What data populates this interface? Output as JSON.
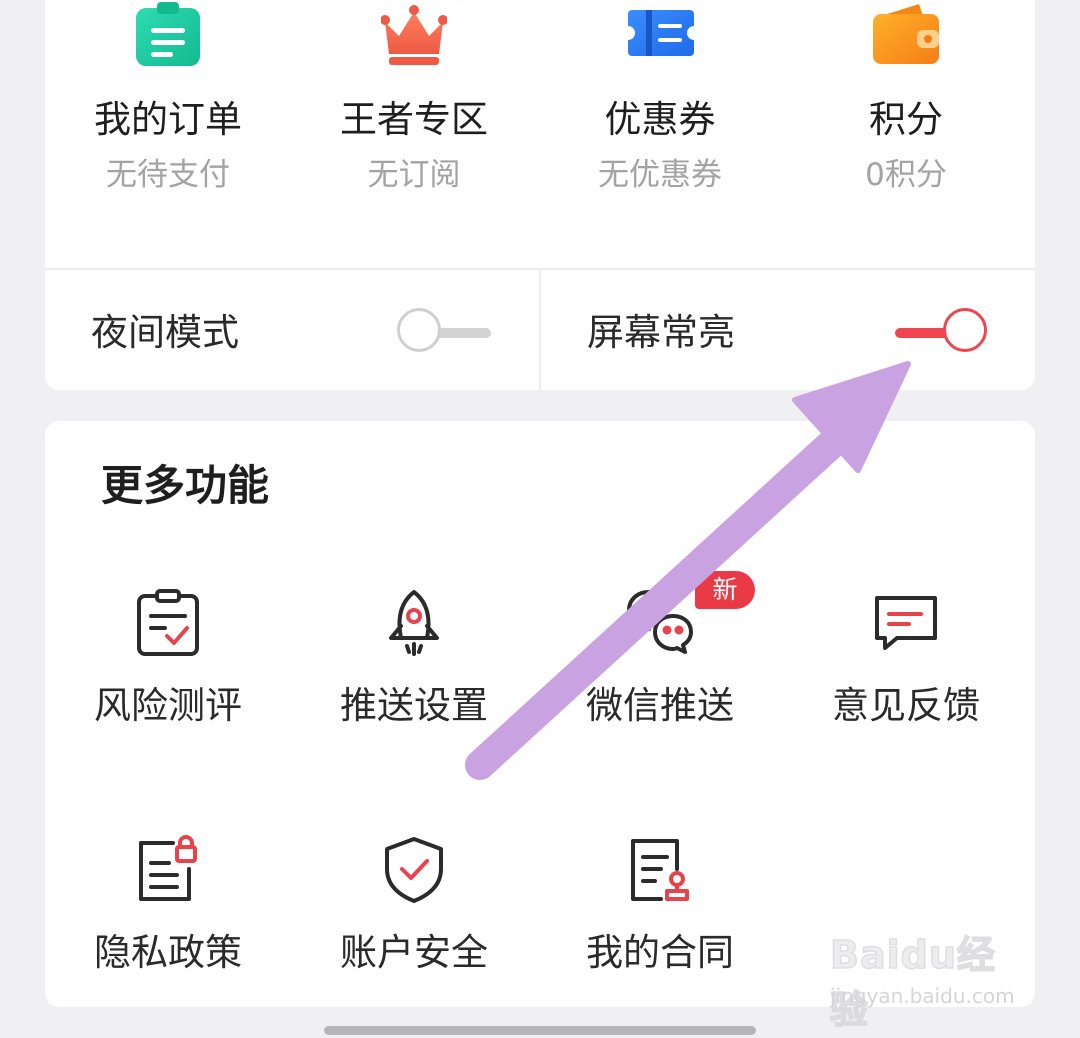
{
  "quick_items": [
    {
      "label": "我的订单",
      "sub": "无待支付",
      "icon": "order-clipboard-icon"
    },
    {
      "label": "王者专区",
      "sub": "无订阅",
      "icon": "crown-icon"
    },
    {
      "label": "优惠券",
      "sub": "无优惠券",
      "icon": "coupon-ticket-icon"
    },
    {
      "label": "积分",
      "sub": "0积分",
      "icon": "wallet-icon"
    }
  ],
  "toggles": {
    "night_mode": {
      "label": "夜间模式",
      "on": false
    },
    "screen_on": {
      "label": "屏幕常亮",
      "on": true
    }
  },
  "more": {
    "title": "更多功能",
    "badge": "新",
    "items": [
      {
        "label": "风险测评",
        "icon": "risk-assessment-icon"
      },
      {
        "label": "推送设置",
        "icon": "rocket-icon"
      },
      {
        "label": "微信推送",
        "icon": "wechat-icon"
      },
      {
        "label": "意见反馈",
        "icon": "feedback-message-icon"
      },
      {
        "label": "隐私政策",
        "icon": "privacy-document-lock-icon"
      },
      {
        "label": "账户安全",
        "icon": "shield-check-icon"
      },
      {
        "label": "我的合同",
        "icon": "contract-stamp-icon"
      }
    ]
  },
  "watermark": {
    "logo": "Baidu经验",
    "url": "jingyan.baidu.com"
  },
  "colors": {
    "accent_red": "#f0454f",
    "order_green": "#1cc9a0",
    "crown_orange": "#f36a4c",
    "coupon_blue": "#2a7af5",
    "wallet_orange": "#fa9a1c",
    "annotation_purple": "#c9a0e0"
  }
}
